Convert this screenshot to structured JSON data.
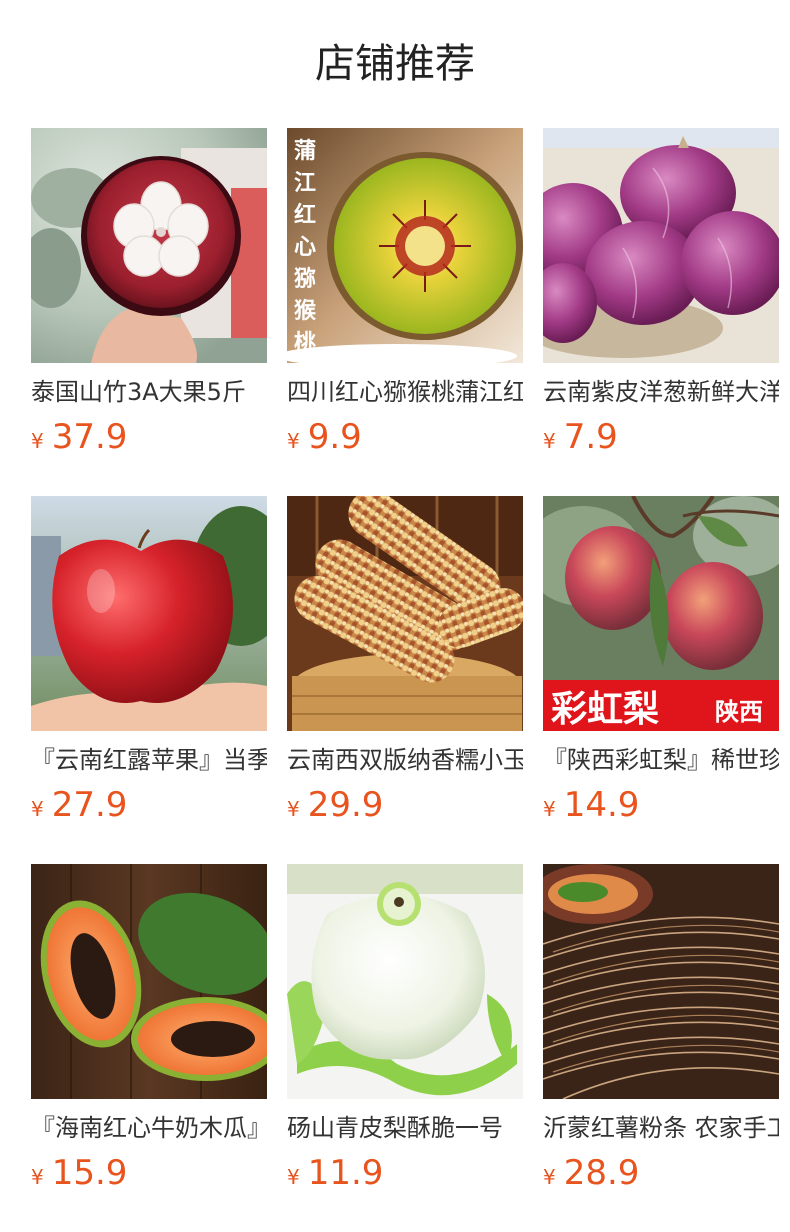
{
  "header": {
    "title": "店铺推荐"
  },
  "products": [
    {
      "name": "泰国山竹3A大果5斤",
      "currency": "¥",
      "price": "37.9",
      "image": "mangosteen-image"
    },
    {
      "name": "四川红心猕猴桃蒲江红心猕猴桃",
      "currency": "¥",
      "price": "9.9",
      "image": "kiwi-image",
      "overlay_text": "蒲江红心猕猴桃"
    },
    {
      "name": "云南紫皮洋葱新鲜大洋葱",
      "currency": "¥",
      "price": "7.9",
      "image": "onion-image"
    },
    {
      "name": "『云南红露苹果』当季新鲜",
      "currency": "¥",
      "price": "27.9",
      "image": "apple-image"
    },
    {
      "name": "云南西双版纳香糯小玉米",
      "currency": "¥",
      "price": "29.9",
      "image": "corn-image"
    },
    {
      "name": "『陕西彩虹梨』稀世珍品",
      "currency": "¥",
      "price": "14.9",
      "image": "rainbow-pear-image",
      "banner_text": "彩虹梨",
      "banner_sub": "陕西"
    },
    {
      "name": "『海南红心牛奶木瓜』",
      "currency": "¥",
      "price": "15.9",
      "image": "papaya-image"
    },
    {
      "name": "砀山青皮梨酥脆一号",
      "currency": "¥",
      "price": "11.9",
      "image": "pear-image"
    },
    {
      "name": "沂蒙红薯粉条 农家手工",
      "currency": "¥",
      "price": "28.9",
      "image": "noodles-image"
    }
  ],
  "colors": {
    "price": "#e8541e",
    "text": "#333333",
    "background": "#ffffff"
  }
}
